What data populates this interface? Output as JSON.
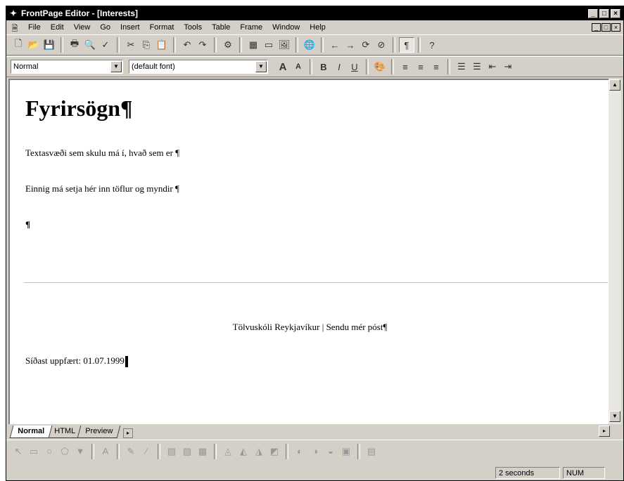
{
  "window": {
    "title": "FrontPage Editor - [Interests]",
    "caption_buttons": [
      "_",
      "□",
      "×"
    ],
    "mdi_buttons": [
      "_",
      "□",
      "×"
    ]
  },
  "menu": [
    "File",
    "Edit",
    "View",
    "Go",
    "Insert",
    "Format",
    "Tools",
    "Table",
    "Frame",
    "Window",
    "Help"
  ],
  "toolbar_standard": {
    "icons": [
      "new-icon",
      "open-icon",
      "save-icon",
      "print-icon",
      "print-preview-icon",
      "spelling-icon",
      "cut-icon",
      "copy-icon",
      "paste-icon",
      "undo-icon",
      "redo-icon",
      "webbot-icon",
      "table-icon",
      "form-field-icon",
      "image-icon",
      "hyperlink-icon",
      "back-icon",
      "forward-icon",
      "refresh-icon",
      "stop-icon",
      "show-paragraph-icon",
      "help-icon"
    ],
    "glyphs": [
      "🗋",
      "📂",
      "💾",
      "🖶",
      "🔍",
      "✓",
      "✂",
      "⎘",
      "📋",
      "↶",
      "↷",
      "⚙",
      "▦",
      "▭",
      "🖼",
      "🌐",
      "←",
      "→",
      "⟳",
      "⊘",
      "¶",
      "?"
    ]
  },
  "toolbar_format": {
    "style_value": "Normal",
    "font_value": "(default font)",
    "icons": [
      "increase-font-icon",
      "decrease-font-icon",
      "bold-icon",
      "italic-icon",
      "underline-icon",
      "text-color-icon",
      "align-left-icon",
      "align-center-icon",
      "align-right-icon",
      "numbered-list-icon",
      "bulleted-list-icon",
      "decrease-indent-icon",
      "increase-indent-icon"
    ],
    "glyphs": [
      "A",
      "A",
      "B",
      "I",
      "U",
      "🎨",
      "≡",
      "≡",
      "≡",
      "☰",
      "☰",
      "⇤",
      "⇥"
    ]
  },
  "document": {
    "heading": "Fyrirsögn¶",
    "paragraph1": "Textasvæði sem skulu má í, hvað sem er ¶",
    "paragraph2": "Einnig má setja hér inn töflur og myndir ¶",
    "paragraph3": "¶",
    "footer_links": "Tölvuskóli Reykjavíkur | Sendu mér póst¶",
    "updated": "Síðast uppfært: 01.07.1999"
  },
  "tabs": [
    "Normal",
    "HTML",
    "Preview"
  ],
  "drawbar": {
    "icons": [
      "pointer-icon",
      "rectangle-icon",
      "circle-icon",
      "polygon-icon",
      "fill-icon",
      "text-icon",
      "pen-icon",
      "line-icon",
      "img1-icon",
      "img2-icon",
      "img3-icon",
      "img4-icon",
      "img5-icon",
      "img6-icon",
      "img7-icon",
      "img8-icon",
      "img9-icon",
      "img10-icon",
      "img11-icon",
      "img12-icon"
    ],
    "glyphs": [
      "↖",
      "▭",
      "○",
      "⬠",
      "▼",
      "A",
      "✎",
      "∕",
      "▨",
      "▧",
      "▩",
      "◬",
      "◭",
      "◮",
      "◩",
      "◐",
      "◑",
      "◒",
      "▣",
      "▤"
    ]
  },
  "status": {
    "message": "",
    "time": "2 seconds",
    "num": "NUM"
  }
}
